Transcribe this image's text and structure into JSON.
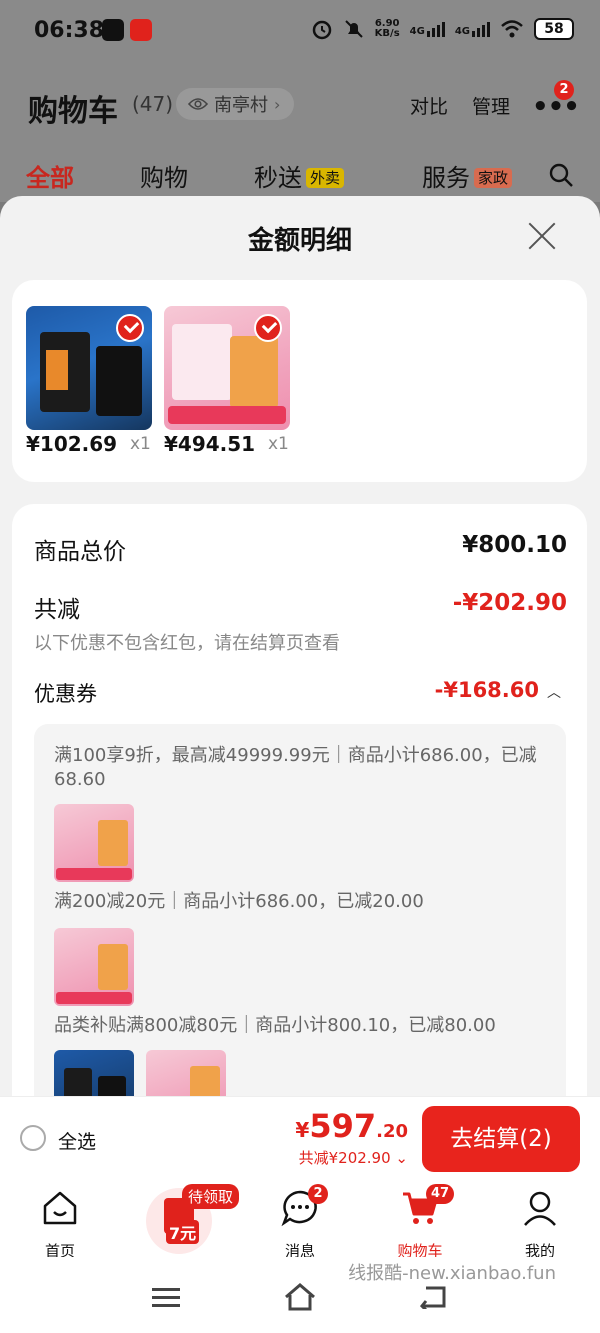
{
  "status_bar": {
    "time": "06:38",
    "net_speed": "6.90",
    "net_unit": "KB/s",
    "signal_1": "4G",
    "signal_2": "4G",
    "battery": "58"
  },
  "cart_header": {
    "title": "购物车",
    "count": "(47)",
    "location": "南亭村",
    "compare": "对比",
    "manage": "管理",
    "more_badge": "2"
  },
  "tabs": [
    {
      "label": "全部",
      "active": true
    },
    {
      "label": "购物"
    },
    {
      "label": "秒送",
      "tag": "外卖"
    },
    {
      "label": "服务",
      "tag": "家政"
    }
  ],
  "sheet": {
    "title": "金额明细",
    "products": [
      {
        "price": "¥102.69",
        "qty": "x1"
      },
      {
        "price": "¥494.51",
        "qty": "x1"
      }
    ],
    "total_label": "商品总价",
    "total_value": "¥800.10",
    "reduce_label": "共减",
    "reduce_value": "-¥202.90",
    "reduce_note": "以下优惠不包含红包，请在结算页查看",
    "coupon_label": "优惠券",
    "coupon_value": "-¥168.60",
    "coupons": [
      "满100享9折，最高减49999.99元｜商品小计686.00，已减68.60",
      "满200减20元｜商品小计686.00，已减20.00",
      "品类补贴满800减80元｜商品小计800.10，已减80.00"
    ]
  },
  "checkout": {
    "select_all": "全选",
    "price_currency": "¥",
    "price_int": "597",
    "price_dec": ".20",
    "saving": "共减¥202.90",
    "button": "去结算(2)"
  },
  "tabbar": {
    "home": "首页",
    "promo_tag": "待领取",
    "promo_amount": "7元",
    "messages": "消息",
    "messages_badge": "2",
    "cart": "购物车",
    "cart_badge": "47",
    "mine": "我的"
  },
  "watermark": "线报酷-new.xianbao.fun",
  "colors": {
    "accent_red": "#e0221c",
    "overlay_gray": "#8a8a8a",
    "sheet_bg": "#f2f2f2"
  }
}
